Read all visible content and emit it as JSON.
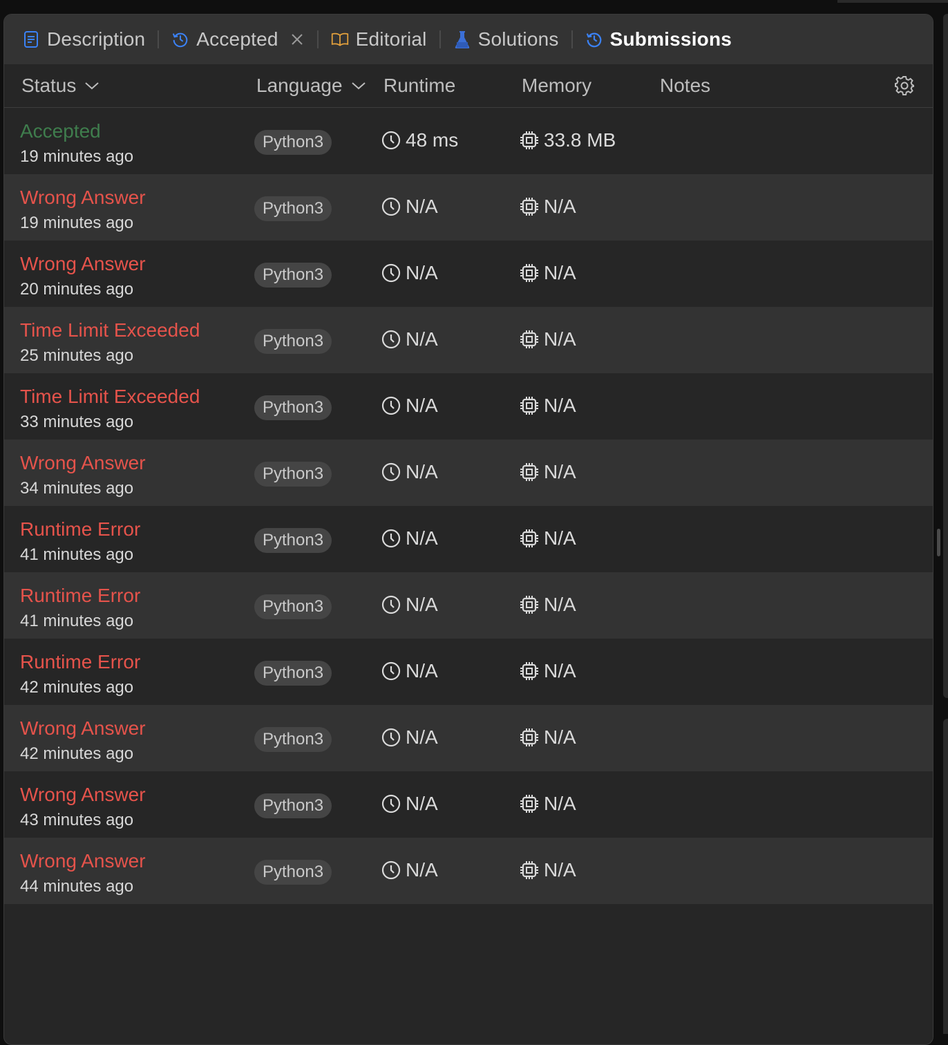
{
  "tabs": [
    {
      "label": "Description",
      "icon": "description-icon",
      "color": "#3b82f6"
    },
    {
      "label": "Accepted",
      "icon": "history-icon",
      "color": "#3b82f6"
    },
    {
      "label": "Editorial",
      "icon": "book-icon",
      "color": "#e6a23c"
    },
    {
      "label": "Solutions",
      "icon": "flask-icon",
      "color": "#3b82f6"
    },
    {
      "label": "Submissions",
      "icon": "history-icon",
      "color": "#3b82f6"
    }
  ],
  "table": {
    "headers": {
      "status": "Status",
      "language": "Language",
      "runtime": "Runtime",
      "memory": "Memory",
      "notes": "Notes"
    },
    "rows": [
      {
        "status": "Accepted",
        "time": "19 minutes ago",
        "language": "Python3",
        "runtime": "48 ms",
        "memory": "33.8 MB"
      },
      {
        "status": "Wrong Answer",
        "time": "19 minutes ago",
        "language": "Python3",
        "runtime": "N/A",
        "memory": "N/A"
      },
      {
        "status": "Wrong Answer",
        "time": "20 minutes ago",
        "language": "Python3",
        "runtime": "N/A",
        "memory": "N/A"
      },
      {
        "status": "Time Limit Exceeded",
        "time": "25 minutes ago",
        "language": "Python3",
        "runtime": "N/A",
        "memory": "N/A"
      },
      {
        "status": "Time Limit Exceeded",
        "time": "33 minutes ago",
        "language": "Python3",
        "runtime": "N/A",
        "memory": "N/A"
      },
      {
        "status": "Wrong Answer",
        "time": "34 minutes ago",
        "language": "Python3",
        "runtime": "N/A",
        "memory": "N/A"
      },
      {
        "status": "Runtime Error",
        "time": "41 minutes ago",
        "language": "Python3",
        "runtime": "N/A",
        "memory": "N/A"
      },
      {
        "status": "Runtime Error",
        "time": "41 minutes ago",
        "language": "Python3",
        "runtime": "N/A",
        "memory": "N/A"
      },
      {
        "status": "Runtime Error",
        "time": "42 minutes ago",
        "language": "Python3",
        "runtime": "N/A",
        "memory": "N/A"
      },
      {
        "status": "Wrong Answer",
        "time": "42 minutes ago",
        "language": "Python3",
        "runtime": "N/A",
        "memory": "N/A"
      },
      {
        "status": "Wrong Answer",
        "time": "43 minutes ago",
        "language": "Python3",
        "runtime": "N/A",
        "memory": "N/A"
      },
      {
        "status": "Wrong Answer",
        "time": "44 minutes ago",
        "language": "Python3",
        "runtime": "N/A",
        "memory": "N/A"
      }
    ]
  },
  "colors": {
    "accepted": "#3f7d4d",
    "error": "#e5534b",
    "active_tab_icon": "#3b82f6"
  }
}
